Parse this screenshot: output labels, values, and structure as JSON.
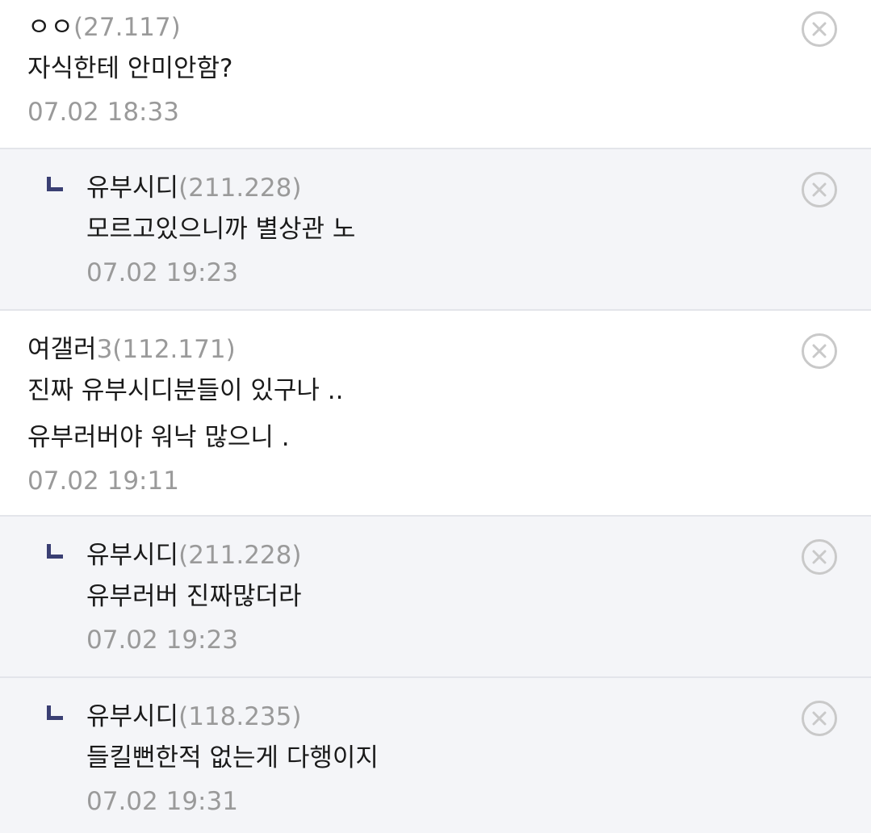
{
  "comments": [
    {
      "nick": "ㅇㅇ",
      "nick_suffix": "",
      "ip": "(27.117)",
      "lines": [
        "자식한테 안미안함?"
      ],
      "time": "07.02 18:33",
      "reply": false
    },
    {
      "nick": "유부시디",
      "nick_suffix": "",
      "ip": "(211.228)",
      "lines": [
        "모르고있으니까 별상관 노"
      ],
      "time": "07.02 19:23",
      "reply": true
    },
    {
      "nick": "여갤러",
      "nick_suffix": "3",
      "ip": "(112.171)",
      "lines": [
        "진짜 유부시디분들이 있구나 ..",
        "유부러버야 워낙 많으니 ."
      ],
      "time": "07.02 19:11",
      "reply": false
    },
    {
      "nick": "유부시디",
      "nick_suffix": "",
      "ip": "(211.228)",
      "lines": [
        "유부러버 진짜많더라"
      ],
      "time": "07.02 19:23",
      "reply": true
    },
    {
      "nick": "유부시디",
      "nick_suffix": "",
      "ip": "(118.235)",
      "lines": [
        "들킬뻔한적 없는게 다행이지"
      ],
      "time": "07.02 19:31",
      "reply": true
    }
  ],
  "icons": {
    "reply": "reply-arrow-icon",
    "delete": "close-circle-icon"
  },
  "colors": {
    "reply_marker": "#3a3f73",
    "reply_background": "#f4f5f8",
    "meta_text": "#9a9a9a"
  }
}
